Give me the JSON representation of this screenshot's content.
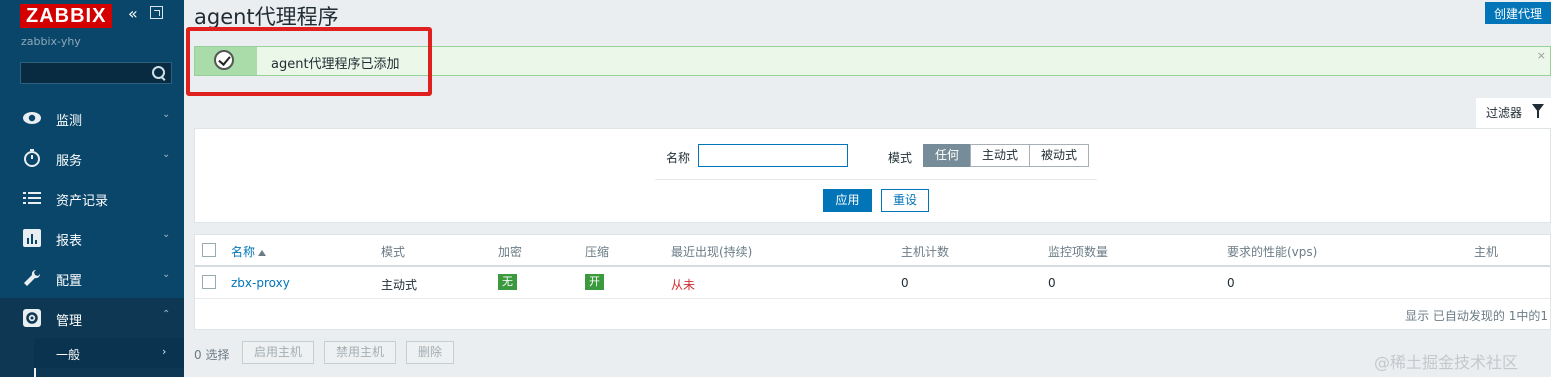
{
  "sidebar": {
    "logo": "ZABBIX",
    "collapse_icon": "double-chevron-left-icon",
    "kiosk_icon": "fullscreen-icon",
    "server_name": "zabbix-yhy",
    "search_placeholder": "",
    "menu": [
      {
        "label": "监测",
        "icon": "eye-icon"
      },
      {
        "label": "服务",
        "icon": "clock-icon"
      },
      {
        "label": "资产记录",
        "icon": "list-icon"
      },
      {
        "label": "报表",
        "icon": "bar-chart-icon"
      },
      {
        "label": "配置",
        "icon": "wrench-icon"
      },
      {
        "label": "管理",
        "icon": "gear-icon",
        "expanded": true
      }
    ],
    "submenu": [
      {
        "label": "一般"
      }
    ]
  },
  "header": {
    "title": "agent代理程序",
    "create_button": "创建代理"
  },
  "message": {
    "text": "agent代理程序已添加",
    "icon": "check-circle-icon",
    "close": "×"
  },
  "filter": {
    "tab_label": "过滤器",
    "name_label": "名称",
    "name_value": "",
    "mode_label": "模式",
    "mode_options": [
      "任何",
      "主动式",
      "被动式"
    ],
    "mode_selected": "任何",
    "apply": "应用",
    "reset": "重设"
  },
  "table": {
    "columns": [
      "名称",
      "模式",
      "加密",
      "压缩",
      "最近出现(持续)",
      "主机计数",
      "监控项数量",
      "要求的性能(vps)",
      "主机"
    ],
    "sort_column": "名称",
    "rows": [
      {
        "name": "zbx-proxy",
        "mode": "主动式",
        "encryption": "无",
        "compression": "开",
        "last_seen": "从未",
        "host_count": "0",
        "item_count": "0",
        "nvps": "0",
        "hosts": ""
      }
    ],
    "footer": "显示 已自动发现的 1中的1"
  },
  "actions": {
    "selected": "0 选择",
    "buttons": [
      "启用主机",
      "禁用主机",
      "删除"
    ]
  },
  "watermark": "@稀土掘金技术社区",
  "colors": {
    "sidebar": "#0a466a",
    "accent": "#0275b8",
    "logo_red": "#d40000",
    "success_bg": "#eaf7e9",
    "badge_green": "#3a9a3d",
    "highlight_red": "#e01f1f"
  }
}
